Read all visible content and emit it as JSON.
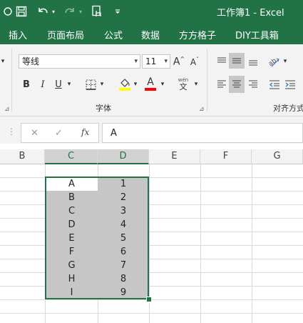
{
  "window": {
    "title": "工作簿1 - Excel"
  },
  "quick_access": {
    "autosave_icon": "circle-icon",
    "save_icon": "save-icon",
    "undo_icon": "undo-icon",
    "redo_icon": "redo-icon",
    "touch_icon": "touch-mode-icon",
    "customize_icon": "customize-icon"
  },
  "ribbon_tabs": [
    "插入",
    "页面布局",
    "公式",
    "数据",
    "方方格子",
    "DIY工具箱"
  ],
  "font_group": {
    "label": "字体",
    "font_name": "等线",
    "font_size": "11",
    "grow_font": "A^",
    "shrink_font": "A˅",
    "bold": "B",
    "italic": "I",
    "underline": "U",
    "fill_color": "#ffff00",
    "font_color": "#ff0000",
    "font_color_letter": "A",
    "phonetic_top": "wén",
    "phonetic_bottom": "文"
  },
  "alignment_group": {
    "label": "对齐方式"
  },
  "formula_bar": {
    "cancel": "✕",
    "enter": "✓",
    "fx": "fx",
    "value": "A"
  },
  "columns": [
    "B",
    "C",
    "D",
    "E",
    "F",
    "G"
  ],
  "selected_columns": [
    "C",
    "D"
  ],
  "cells": {
    "C": [
      "A",
      "B",
      "C",
      "D",
      "E",
      "F",
      "G",
      "H",
      "I"
    ],
    "D": [
      "1",
      "2",
      "3",
      "4",
      "5",
      "6",
      "7",
      "8",
      "9"
    ]
  },
  "colors": {
    "accent": "#217346",
    "selection_fill": "#c6c6c6",
    "header_selected": "#d2d2d2"
  }
}
